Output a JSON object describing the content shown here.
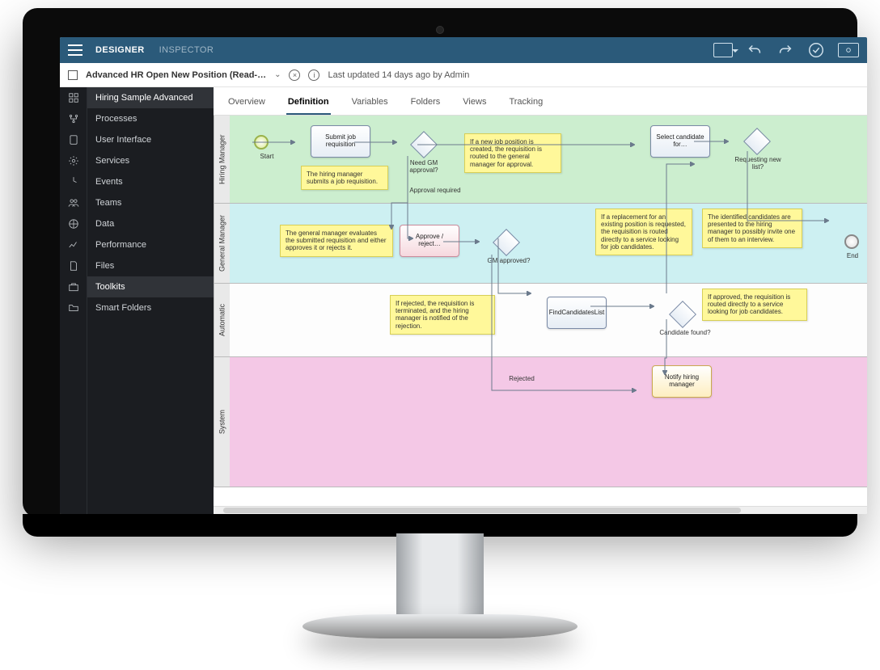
{
  "topbar": {
    "mode_designer": "DESIGNER",
    "mode_inspector": "INSPECTOR"
  },
  "title": {
    "proc_name": "Advanced HR Open New Position (Read-…",
    "meta": "Last updated 14 days ago by Admin"
  },
  "sidebar": {
    "items": [
      "Hiring Sample Advanced",
      "Processes",
      "User Interface",
      "Services",
      "Events",
      "Teams",
      "Data",
      "Performance",
      "Files",
      "Toolkits",
      "Smart Folders"
    ],
    "active_index": 9
  },
  "tabs": {
    "items": [
      "Overview",
      "Definition",
      "Variables",
      "Folders",
      "Views",
      "Tracking"
    ],
    "active_index": 1
  },
  "lanes": [
    "Hiring Manager",
    "General Manager",
    "Automatic",
    "System"
  ],
  "bpmn": {
    "start_label": "Start",
    "end_label": "End",
    "tasks": {
      "submit": "Submit job requisition",
      "approve": "Approve / reject…",
      "select": "Select candidate for…",
      "find": "FindCandidatesList",
      "notify": "Notify hiring manager"
    },
    "gateways": {
      "need_gm": "Need GM approval?",
      "gm_approved": "GM approved?",
      "requesting": "Requesting new list?",
      "cand_found": "Candidate found?"
    },
    "edge_labels": {
      "approval_required": "Approval required",
      "rejected": "Rejected"
    },
    "notes": {
      "n1": "The hiring manager submits a job requisition.",
      "n2": "If a new job position is created, the requisition is routed to the general manager for approval.",
      "n3": "The general manager evaluates the submitted requisition and either approves it or rejects it.",
      "n4": "If rejected, the requisition is terminated, and the hiring manager is notified of the rejection.",
      "n5": "If a replacement for an existing position is requested, the requisition is routed directly to a service looking for job candidates.",
      "n6": "The identified candidates are presented to the hiring manager to possibly invite one of them to an interview.",
      "n7": "If approved, the requisition is routed directly to a service looking for job candidates."
    }
  }
}
